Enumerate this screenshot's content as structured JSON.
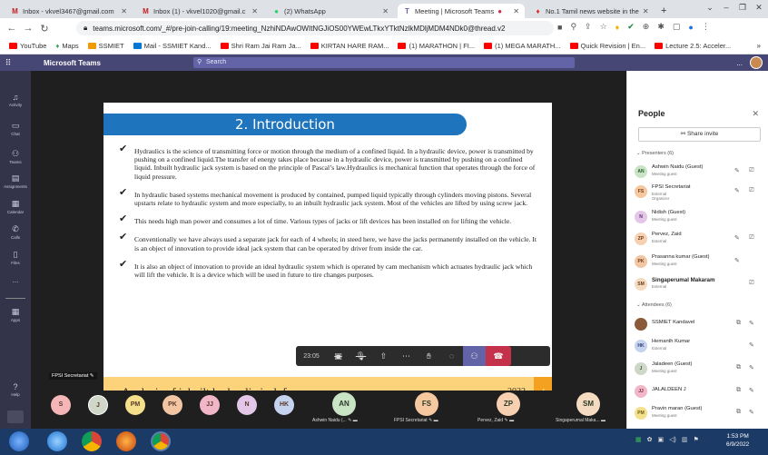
{
  "browser": {
    "tabs": [
      {
        "label": "Inbox - vkvel3467@gmail.com",
        "icon": "gmail-icon",
        "color": "#c5221f"
      },
      {
        "label": "Inbox (1) - vkvel1020@gmail.c",
        "icon": "gmail-icon",
        "color": "#c5221f"
      },
      {
        "label": "(2) WhatsApp",
        "icon": "whatsapp-icon",
        "color": "#25d366"
      },
      {
        "label": "Meeting | Microsoft Teams",
        "icon": "teams-icon",
        "color": "#6264a7"
      },
      {
        "label": "No.1 Tamil news website in the",
        "icon": "news-icon",
        "color": "#d93025"
      }
    ],
    "url": "teams.microsoft.com/_#/pre-join-calling/19:meeting_NzhiNDAwOWItNGJiOS00YWEwLTkxYTktNzlkMDljMDM4NDk0@thread.v2",
    "bookmarks": [
      "YouTube",
      "Maps",
      "SSMIET",
      "Mail - SSMIET Kand...",
      "Shri Ram Jai Ram Ja...",
      "KIRTAN HARE RAM...",
      "(1) MARATHON | FI...",
      "(1) MEGA MARATH...",
      "Quick Revision | En...",
      "Lecture 2.5: Acceler..."
    ],
    "bookmark_more": "»"
  },
  "teams": {
    "app_name": "Microsoft Teams",
    "search_placeholder": "Search",
    "more": "...",
    "rail": [
      "Activity",
      "Chat",
      "Teams",
      "Assignments",
      "Calendar",
      "Calls",
      "Files",
      "...",
      "Apps",
      "Help"
    ]
  },
  "slide": {
    "title": "2. Introduction",
    "bullets": [
      "Hydraulics is the science of transmitting force or motion through the medium of a confined liquid. In a hydraulic device, power is transmitted by pushing on a confined liquid.The transfer of energy takes place because in a hydraulic device, power is transmitted by pushing on a confined liquid. Inbuilt hydraulic jack system is based on the principle of Pascal’s law.Hydraulics is mechanical function that operates through the force of liquid pressure.",
      "In hydraulic based systems mechanical movement is produced by contained, pumped liquid typically through cylinders moving pistons. Several upstarts relate to hydraulic system and more especially, to an inbuilt hydraulic jack system. Most of the vehicles are lifted by using screw jack.",
      "This needs high man power and consumes a lot of time. Various types of jacks or lift devices has been installed on for lifting the vehicle.",
      "Conventionally we have always used a separate jack for each of 4 wheels; in steed here, we have the jacks permanently installed on the vehicle. It is an object of innovation to provide ideal jack system that can be operated by driver from inside the car.",
      "It is also an object of innovation to provide an ideal hydraulic system which is operated by cam mechanism which actuates hydraulic jack which will lift the vehicle. It is a device which will be used in future to tire changes purposes."
    ],
    "footer_text": "Analysis of inbuilt hydraulic jack fo",
    "year": "2022",
    "page_number": "4"
  },
  "presenter_label": "FPSI Secretariat",
  "controls": {
    "timer": "23:05"
  },
  "strip": {
    "small": [
      {
        "initials": "S",
        "color": "#f4b6b6"
      },
      {
        "initials": "J",
        "color": "#cfd8c8"
      },
      {
        "initials": "PM",
        "color": "#f4e08a"
      },
      {
        "initials": "PK",
        "color": "#f3c6a3"
      },
      {
        "initials": "JJ",
        "color": "#f1b7c9"
      },
      {
        "initials": "N",
        "color": "#e3c6e8"
      },
      {
        "initials": "HK",
        "color": "#c6d3ee"
      }
    ],
    "big": [
      {
        "initials": "AN",
        "name": "Ashwin Naidu (...",
        "color": "#c9e4c5"
      },
      {
        "initials": "FS",
        "name": "FPSI Secretariat",
        "color": "#f6c8a0"
      },
      {
        "initials": "ZP",
        "name": "Pervez, Zaid",
        "color": "#f6d0b0"
      },
      {
        "initials": "SM",
        "name": "Singaperumal Maka...",
        "color": "#f5dcc0"
      }
    ]
  },
  "people": {
    "title": "People",
    "share_invite": "Share invite",
    "presenters_label": "Presenters (6)",
    "presenters": [
      {
        "initials": "AN",
        "name": "Ashwin Naidu (Guest)",
        "role": "Meeting guest",
        "color": "#c9e4c5"
      },
      {
        "initials": "FS",
        "name": "FPSI Secretariat",
        "role": "External\nOrganizer",
        "color": "#f6c8a0"
      },
      {
        "initials": "N",
        "name": "Nidish (Guest)",
        "role": "Meeting guest",
        "color": "#e3c6e8"
      },
      {
        "initials": "ZP",
        "name": "Pervez, Zaid",
        "role": "External",
        "color": "#f6d0b0"
      },
      {
        "initials": "PK",
        "name": "Prasanna kumar (Guest)",
        "role": "Meeting guest",
        "color": "#f3c6a3"
      },
      {
        "initials": "SM",
        "name": "Singaperumal Makaram",
        "role": "External",
        "color": "#f5dcc0"
      }
    ],
    "attendees_label": "Attendees (6)",
    "attendees": [
      {
        "initials": "",
        "name": "SSMIET Kandavel",
        "role": "",
        "color": "#8a5a3a"
      },
      {
        "initials": "HK",
        "name": "Hemanth Kumar",
        "role": "External",
        "color": "#c6d3ee"
      },
      {
        "initials": "J",
        "name": "Jaladeen (Guest)",
        "role": "Meeting guest",
        "color": "#cfd8c8"
      },
      {
        "initials": "JJ",
        "name": "JALALDEEN J",
        "role": "",
        "color": "#f1b7c9"
      },
      {
        "initials": "PM",
        "name": "Pravin maran (Guest)",
        "role": "Meeting guest",
        "color": "#f4e08a"
      }
    ]
  },
  "taskbar": {
    "time": "1:53 PM",
    "date": "6/9/2022"
  }
}
